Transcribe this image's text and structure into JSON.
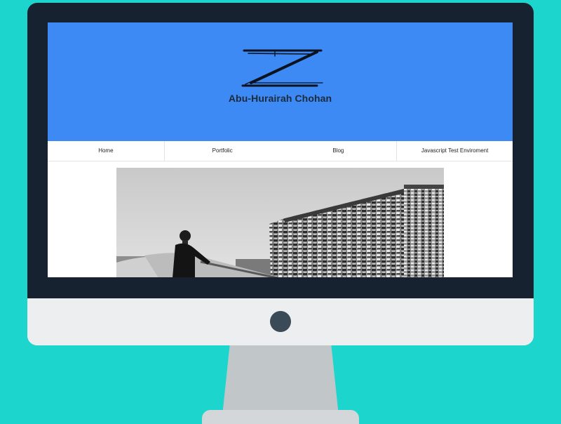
{
  "site": {
    "title": "Abu-Hurairah Chohan",
    "logo_letter": "Z"
  },
  "nav": {
    "items": [
      {
        "label": "Home"
      },
      {
        "label": "Portfolic"
      },
      {
        "label": "Blog"
      },
      {
        "label": "Javascript Test Enviroment"
      }
    ]
  },
  "hero_image": {
    "description_icon": "photo-building-person"
  },
  "colors": {
    "background": "#1cd6cd",
    "bezel": "#172230",
    "hero": "#3e8af5",
    "chin": "#edeeef",
    "stand": "#c1c6c8"
  }
}
